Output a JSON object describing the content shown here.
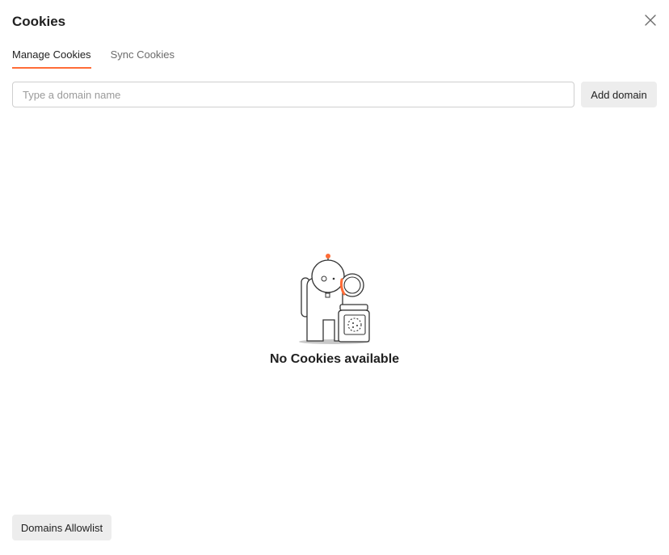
{
  "modal": {
    "title": "Cookies"
  },
  "tabs": [
    {
      "label": "Manage Cookies",
      "active": true
    },
    {
      "label": "Sync Cookies",
      "active": false
    }
  ],
  "domain_input": {
    "placeholder": "Type a domain name",
    "value": ""
  },
  "add_domain_label": "Add domain",
  "empty_state": {
    "message": "No Cookies available",
    "illustration": "astronaut-cookie-jar-illustration"
  },
  "footer": {
    "allowlist_label": "Domains Allowlist"
  },
  "icons": {
    "close": "close-icon"
  },
  "colors": {
    "accent": "#ff6c37",
    "button_bg": "#ededed",
    "border": "#cfcfcf"
  }
}
